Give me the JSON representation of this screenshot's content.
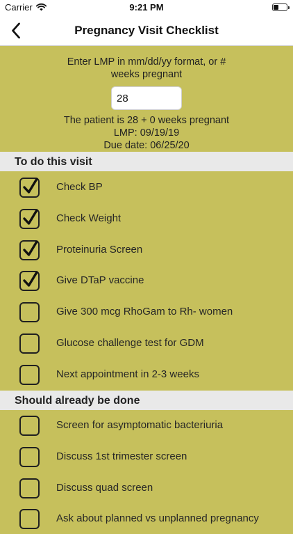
{
  "status_bar": {
    "carrier": "Carrier",
    "time": "9:21 PM"
  },
  "nav": {
    "title": "Pregnancy Visit Checklist"
  },
  "entry": {
    "prompt_line1": "Enter LMP in mm/dd/yy format, or #",
    "prompt_line2": "weeks pregnant",
    "input_value": "28",
    "result_weeks": "The patient is 28 + 0 weeks pregnant",
    "result_lmp": "LMP: 09/19/19",
    "result_due": "Due date: 06/25/20"
  },
  "sections": {
    "todo_title": "To do this visit",
    "done_title": "Should already be done"
  },
  "todo": [
    {
      "label": "Check BP",
      "checked": true
    },
    {
      "label": "Check Weight",
      "checked": true
    },
    {
      "label": "Proteinuria Screen",
      "checked": true
    },
    {
      "label": "Give DTaP vaccine",
      "checked": true
    },
    {
      "label": "Give 300 mcg RhoGam to Rh- women",
      "checked": false
    },
    {
      "label": "Glucose challenge test for GDM",
      "checked": false
    },
    {
      "label": "Next appointment in 2-3 weeks",
      "checked": false
    }
  ],
  "done": [
    {
      "label": "Screen for asymptomatic bacteriuria",
      "checked": false
    },
    {
      "label": "Discuss 1st trimester screen",
      "checked": false
    },
    {
      "label": "Discuss quad screen",
      "checked": false
    },
    {
      "label": "Ask about planned vs unplanned pregnancy",
      "checked": false
    }
  ],
  "colors": {
    "background": "#c6c05c",
    "section_header": "#e9e9e9",
    "nav_background": "#ffffff"
  },
  "icons": {
    "back": "chevron-left-icon",
    "wifi": "wifi-icon",
    "battery": "battery-icon",
    "check": "checkmark-icon"
  }
}
